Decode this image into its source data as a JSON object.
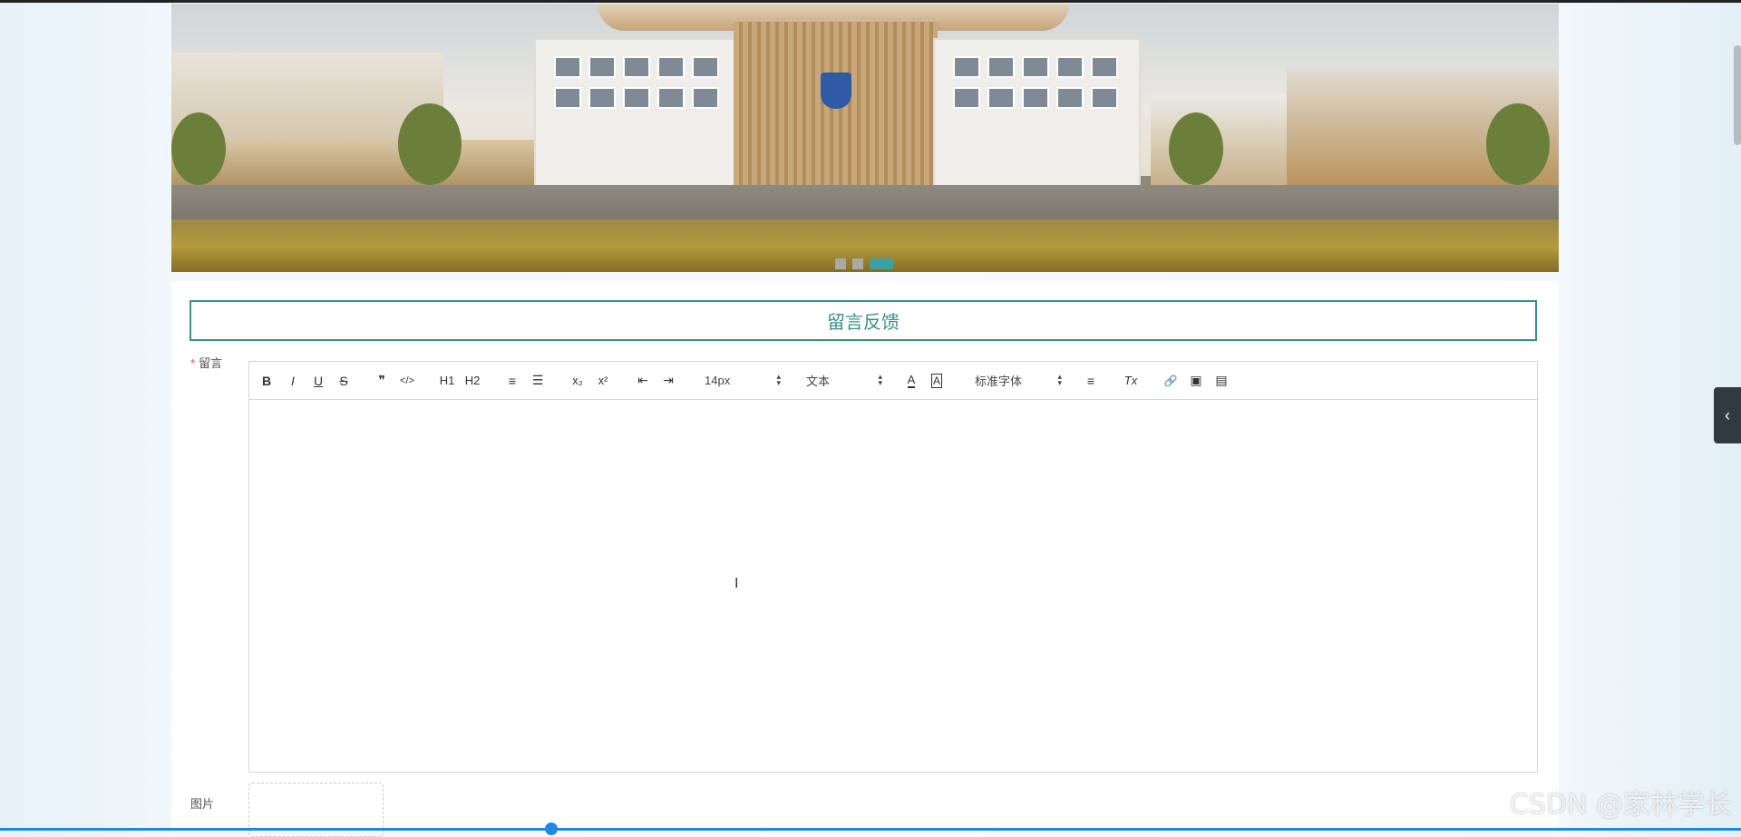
{
  "form": {
    "title": "留言反馈",
    "message_label": "留言",
    "required_mark": "*",
    "image_label": "图片"
  },
  "toolbar": {
    "bold": "B",
    "italic": "I",
    "underline": "U",
    "strike": "S",
    "quote": "❞",
    "code": "</>",
    "h1": "H1",
    "h2": "H2",
    "ordered_list": "≡",
    "bullet_list": "☰",
    "subscript": "x₂",
    "superscript": "x²",
    "outdent": "⇤",
    "indent": "⇥",
    "font_size": "14px",
    "block_type": "文本",
    "font_color": "A",
    "background_color": "A",
    "font_family": "标准字体",
    "align": "≡",
    "clean": "Tx",
    "link": "🔗",
    "image": "▣",
    "video": "▤"
  },
  "banner": {
    "slides": 3,
    "active_slide": 3
  },
  "side_tab": {
    "arrow": "‹"
  },
  "watermark": "CSDN @家林学长",
  "colors": {
    "accent": "#3a918b",
    "required": "#e24c4c"
  }
}
